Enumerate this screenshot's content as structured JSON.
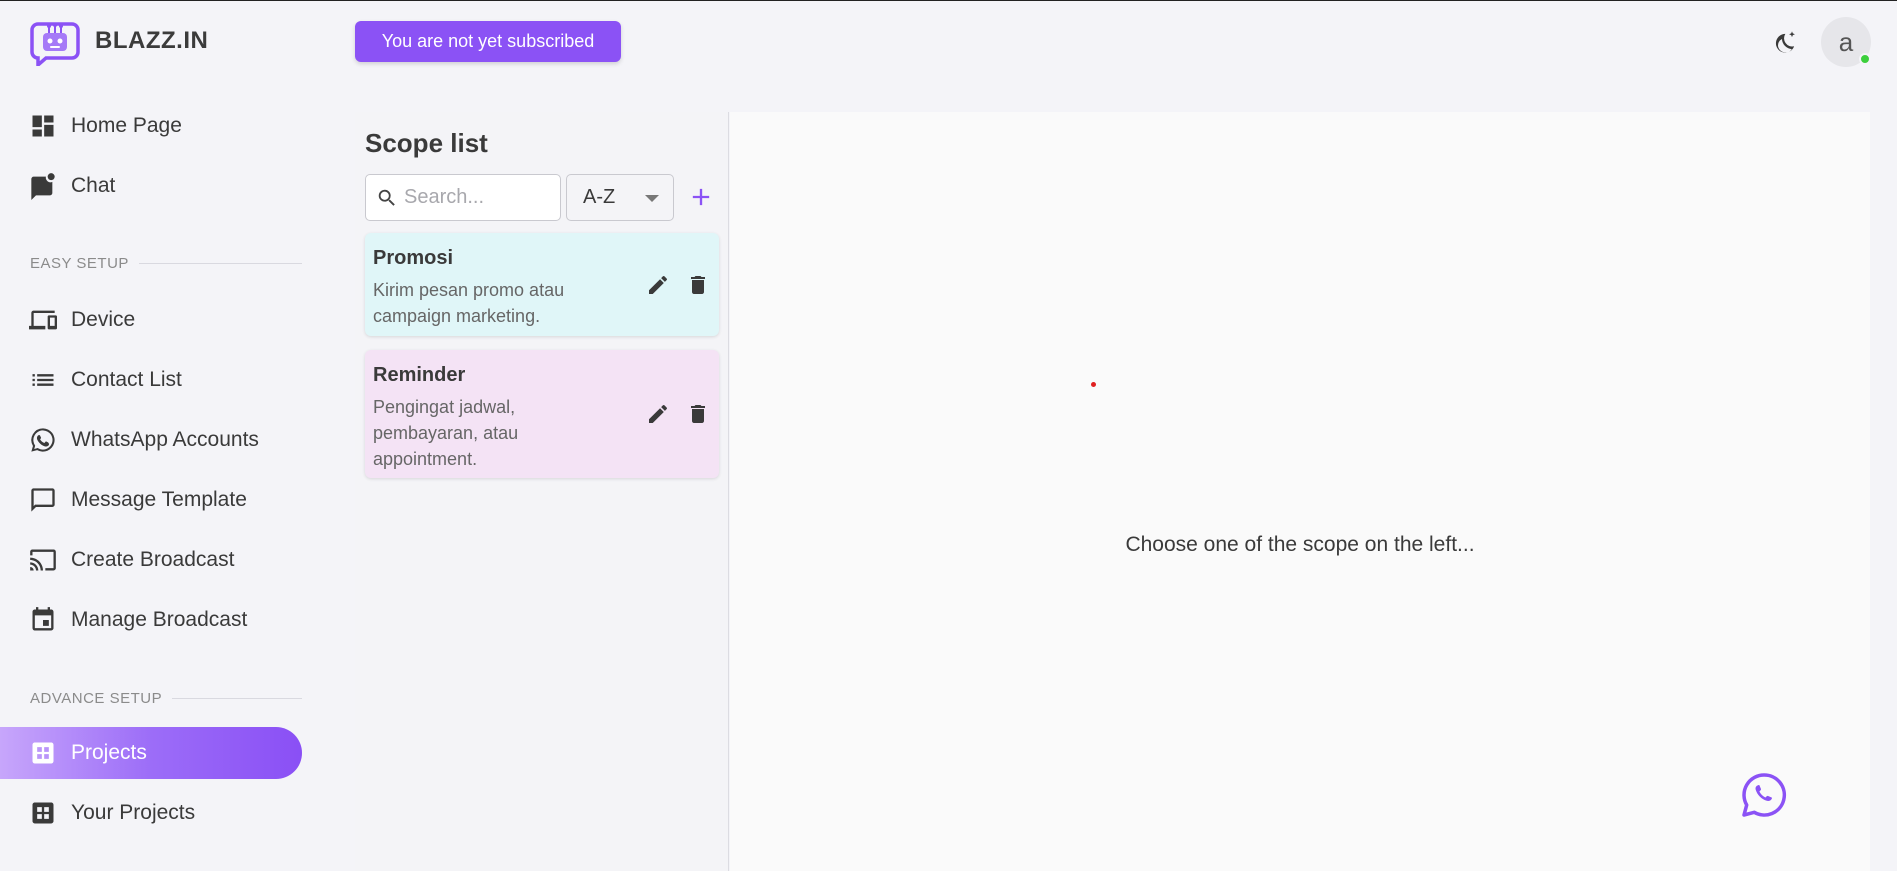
{
  "brand": {
    "name": "BLAZZ.IN"
  },
  "subscription_badge": "You are not yet subscribed",
  "avatar": {
    "initial": "a"
  },
  "sidebar": {
    "main_items": [
      {
        "label": "Home Page",
        "icon": "dashboard-icon"
      },
      {
        "label": "Chat",
        "icon": "chat-icon"
      }
    ],
    "easy_setup_label": "EASY SETUP",
    "easy_setup_items": [
      {
        "label": "Device",
        "icon": "devices-icon"
      },
      {
        "label": "Contact List",
        "icon": "list-icon"
      },
      {
        "label": "WhatsApp Accounts",
        "icon": "whatsapp-icon"
      },
      {
        "label": "Message Template",
        "icon": "message-icon"
      },
      {
        "label": "Create Broadcast",
        "icon": "cast-icon"
      },
      {
        "label": "Manage Broadcast",
        "icon": "calendar-icon"
      }
    ],
    "advance_setup_label": "ADVANCE SETUP",
    "advance_setup_items": [
      {
        "label": "Projects",
        "icon": "grid-icon",
        "active": true
      },
      {
        "label": "Your Projects",
        "icon": "grid-icon",
        "active": false
      }
    ]
  },
  "scope_panel": {
    "title": "Scope list",
    "search_placeholder": "Search...",
    "sort_value": "A-Z",
    "items": [
      {
        "title": "Promosi",
        "description": "Kirim pesan promo atau campaign marketing."
      },
      {
        "title": "Reminder",
        "description": "Pengingat jadwal, pembayaran, atau appointment."
      }
    ]
  },
  "detail": {
    "empty_message": "Choose one of the scope on the left..."
  },
  "colors": {
    "accent": "#8b52f5",
    "promosi_card": "#e0f6f8",
    "reminder_card": "#f4e3f5"
  }
}
